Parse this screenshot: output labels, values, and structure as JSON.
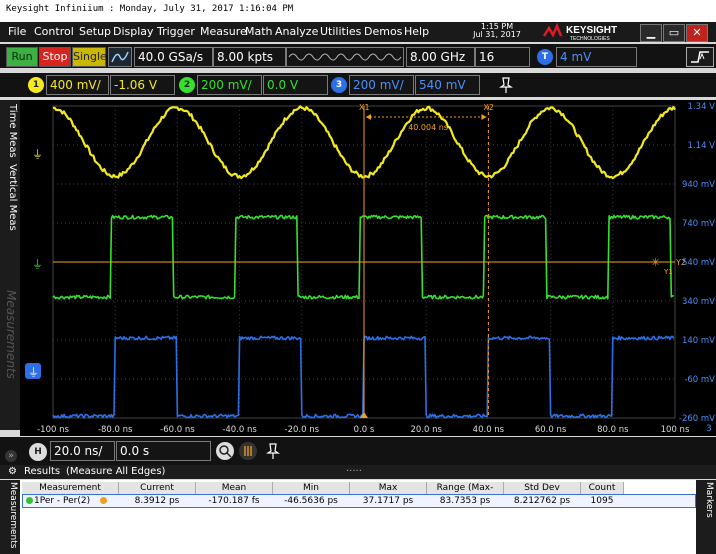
{
  "titlebar": {
    "title": "Keysight Infiniium : Monday, July 31, 2017 1:16:04 PM"
  },
  "menu": {
    "items": [
      "File",
      "Control",
      "Setup",
      "Display",
      "Trigger",
      "Measure",
      "Math",
      "Analyze",
      "Utilities",
      "Demos",
      "Help"
    ]
  },
  "clock": {
    "time": "1:15 PM",
    "date": "Jul 31, 2017"
  },
  "brand": {
    "name": "KEYSIGHT",
    "sub": "TECHNOLOGIES"
  },
  "toolbar": {
    "run_label": "Run",
    "stop_label": "Stop",
    "single_label": "Single",
    "sample_rate": "40.0 GSa/s",
    "memory_depth": "8.00 kpts",
    "bandwidth": "8.00 GHz",
    "averages": "16",
    "trigger_badge": "T",
    "trigger_level": "4 mV"
  },
  "channels": [
    {
      "badge": "1",
      "scale": "400 mV/",
      "offset": "-1.06 V",
      "color": "#f2ea1d"
    },
    {
      "badge": "2",
      "scale": "200 mV/",
      "offset": "0.0 V",
      "color": "#35e02e"
    },
    {
      "badge": "3",
      "scale": "200 mV/",
      "offset": "540 mV",
      "color": "#2e6fe8"
    }
  ],
  "side_tabs": {
    "time_meas": "Time Meas",
    "vertical_meas": "Vertical Meas",
    "measurements": "Measurements"
  },
  "markers": {
    "x1": "X1",
    "x2": "X2",
    "delta": "40.004 ns",
    "y2": "Y2",
    "y1": "Y1"
  },
  "right_labels": [
    "1.34 V",
    "1.14 V",
    "940 mV",
    "740 mV",
    "540 mV",
    "340 mV",
    "140 mV",
    "-60 mV",
    "-260 mV"
  ],
  "time_labels": [
    "-100 ns",
    "-80.0 ns",
    "-60.0 ns",
    "-40.0 ns",
    "-20.0 ns",
    "0.0 s",
    "20.0 ns",
    "40.0 ns",
    "60.0 ns",
    "80.0 ns",
    "100 ns"
  ],
  "corner_number": "3",
  "horizontal": {
    "badge": "H",
    "scale": "20.0 ns/",
    "position": "0.0 s"
  },
  "results": {
    "title": "Results",
    "subtitle": "(Measure All Edges)",
    "right_tab": "Markers",
    "columns": [
      "Measurement",
      "Current",
      "Mean",
      "Min",
      "Max",
      "Range (Max-Min)",
      "Std Dev",
      "Count"
    ],
    "rows": [
      [
        "1Per - Per(2)",
        "8.3912 ps",
        "-170.187 fs",
        "-46.5636 ps",
        "37.1717 ps",
        "83.7353 ps",
        "8.212762 ps",
        "1095"
      ]
    ]
  },
  "chart_data": {
    "type": "line",
    "title": "",
    "xlabel": "",
    "ylabel": "",
    "x_ticks": [
      "-100 ns",
      "-80.0 ns",
      "-60.0 ns",
      "-40.0 ns",
      "-20.0 ns",
      "0.0 s",
      "20.0 ns",
      "40.0 ns",
      "60.0 ns",
      "80.0 ns",
      "100 ns"
    ],
    "xlim_ns": [
      -100,
      100
    ],
    "ylim_mV": [
      -260,
      1340
    ],
    "grid": true,
    "series": [
      {
        "color": "#f2ea1d",
        "shape": "sine",
        "period_ns": 40,
        "peak_ns": -60,
        "min_mV": 980,
        "max_mV": 1330
      },
      {
        "color": "#35e02e",
        "shape": "square",
        "period_ns": 40,
        "rise_ns": [
          -81,
          -41,
          -1,
          39,
          79
        ],
        "fall_ns": [
          -61,
          -21,
          19,
          59,
          99
        ],
        "low_mV": 360,
        "high_mV": 770
      },
      {
        "color": "#2e6fe8",
        "shape": "square",
        "period_ns": 40,
        "rise_ns": [
          -80,
          -40,
          0,
          40,
          80
        ],
        "fall_ns": [
          -60,
          -20,
          20,
          60
        ],
        "low_mV": -250,
        "high_mV": 150
      }
    ],
    "cursors_ns": [
      0,
      40
    ],
    "cursor_delta": "40.004 ns",
    "trigger_level_mV": 540
  }
}
